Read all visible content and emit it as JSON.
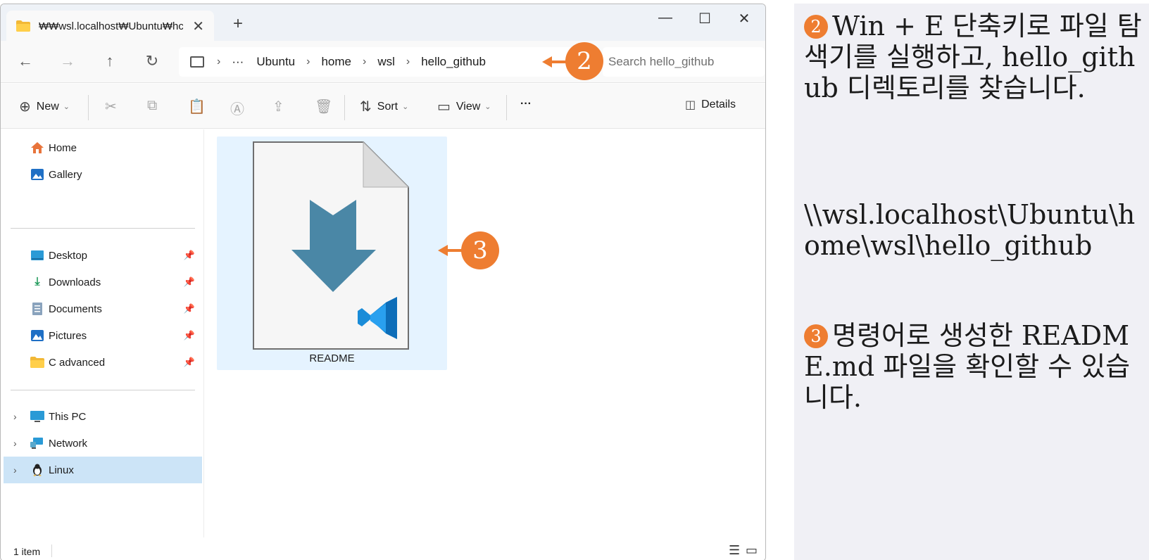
{
  "window": {
    "tab_title": "₩₩wsl.localhost₩Ubuntu₩hc",
    "tab_close": "✕",
    "new_tab": "+",
    "controls": {
      "minimize": "—",
      "maximize": "☐",
      "close": "✕"
    }
  },
  "nav": {
    "back": "←",
    "forward": "→",
    "up": "↑",
    "refresh": "↻",
    "breadcrumb": [
      "Ubuntu",
      "home",
      "wsl",
      "hello_github"
    ],
    "overflow": "···",
    "sep": "›",
    "search_placeholder": "Search hello_github"
  },
  "toolbar": {
    "new_label": "New",
    "sort_label": "Sort",
    "view_label": "View",
    "more_label": "···",
    "details_label": "Details"
  },
  "sidebar": {
    "home": "Home",
    "gallery": "Gallery",
    "quick": [
      "Desktop",
      "Downloads",
      "Documents",
      "Pictures",
      "C advanced"
    ],
    "this_pc": "This PC",
    "network": "Network",
    "linux": "Linux"
  },
  "content": {
    "file_name": "README"
  },
  "status": {
    "count": "1 item"
  },
  "callouts": {
    "two": "2",
    "three": "3"
  },
  "panel": {
    "step2_num": "2",
    "step2_text": "Win + E 단축키로 파일 탐색기를 실행하고, hello_github 디렉토리를 찾습니다.",
    "path_text": "\\\\wsl.localhost\\Ubuntu\\home\\wsl\\hello_github",
    "step3_num": "3",
    "step3_text": "명령어로 생성한 README.md 파일을 확인할 수 있습니다."
  },
  "colors": {
    "accent": "#ee7d31",
    "selection": "#cce4f7",
    "file_selection": "#e5f3ff",
    "arrow_blue": "#4a87a6",
    "vscode_blue": "#1a8cd8"
  }
}
